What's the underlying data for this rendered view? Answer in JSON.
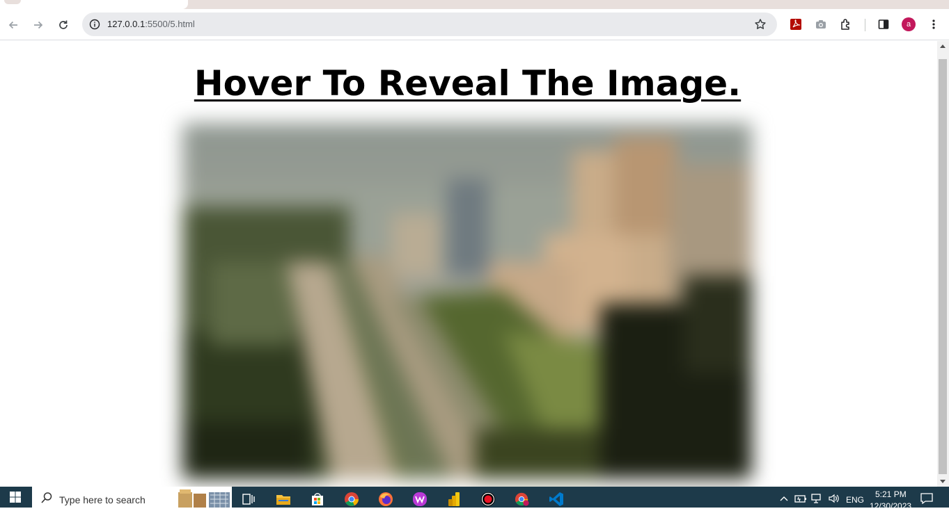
{
  "browser": {
    "url_host": "127.0.0.1",
    "url_rest": ":5500/5.html",
    "profile_initial": "a"
  },
  "page": {
    "heading": "Hover To Reveal The Image."
  },
  "taskbar": {
    "search_placeholder": "Type here to search",
    "language": "ENG",
    "time": "5:21 PM",
    "date": "12/30/2023"
  },
  "colors": {
    "taskbar_bg": "#1d3a4a",
    "avatar_bg": "#c2185b",
    "omnibox_bg": "#e9eaed"
  }
}
